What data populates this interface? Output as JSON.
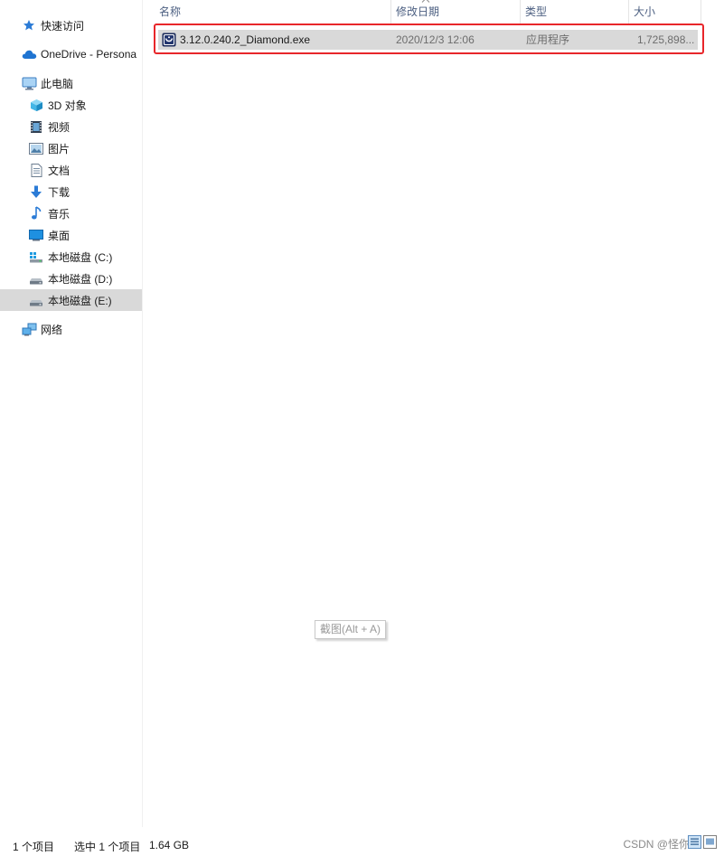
{
  "nav": {
    "quick_access": "快速访问",
    "onedrive": "OneDrive - Persona",
    "this_pc": "此电脑",
    "items": [
      {
        "label": "3D 对象",
        "icon": "3d-objects-icon"
      },
      {
        "label": "视频",
        "icon": "videos-icon"
      },
      {
        "label": "图片",
        "icon": "pictures-icon"
      },
      {
        "label": "文档",
        "icon": "documents-icon"
      },
      {
        "label": "下载",
        "icon": "downloads-icon"
      },
      {
        "label": "音乐",
        "icon": "music-icon"
      },
      {
        "label": "桌面",
        "icon": "desktop-icon"
      },
      {
        "label": "本地磁盘 (C:)",
        "icon": "drive-c-icon"
      },
      {
        "label": "本地磁盘 (D:)",
        "icon": "drive-d-icon"
      },
      {
        "label": "本地磁盘 (E:)",
        "icon": "drive-e-icon",
        "selected": true
      }
    ],
    "network": "网络"
  },
  "columns": {
    "name": "名称",
    "date": "修改日期",
    "type": "类型",
    "size": "大小",
    "sort": "name-ascending"
  },
  "files": [
    {
      "name": "3.12.0.240.2_Diamond.exe",
      "date": "2020/12/3 12:06",
      "type": "应用程序",
      "size": "1,725,898...",
      "selected": true
    }
  ],
  "tooltip": "截图(Alt + A)",
  "status": {
    "count": "1 个项目",
    "selected": "选中 1 个项目",
    "size": "1.64 GB"
  },
  "watermark": "CSDN @怪你",
  "colors": {
    "selection": "#d9d9d9",
    "highlight_border": "#e8262a",
    "header_text": "#4d6082"
  }
}
